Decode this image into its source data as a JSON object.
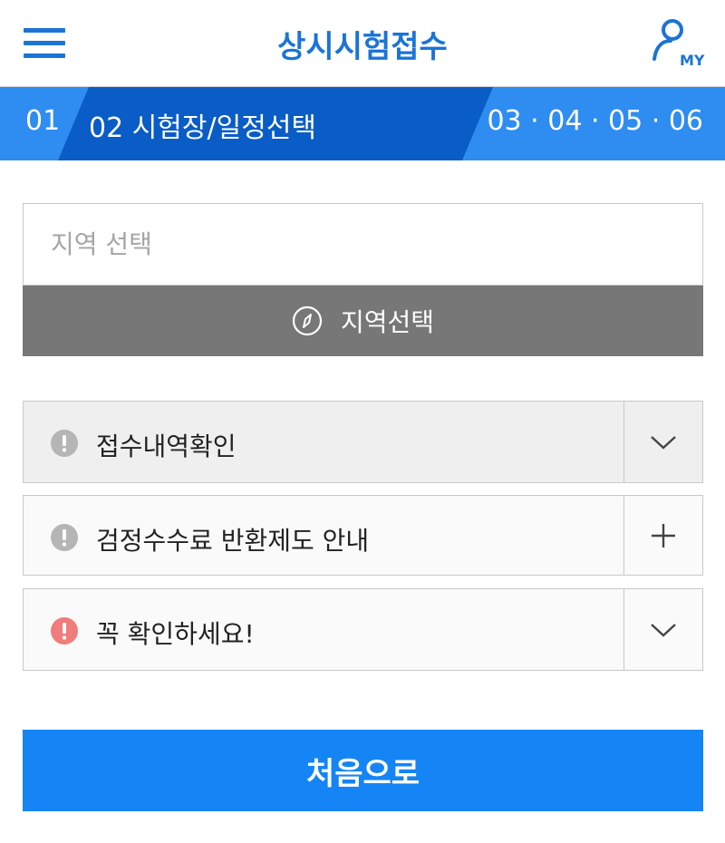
{
  "header": {
    "title": "상시시험접수",
    "my_label": "MY"
  },
  "steps": {
    "first": "01",
    "current": "02  시험장/일정선택",
    "rest": "03 · 04 · 05 · 06"
  },
  "region": {
    "placeholder": "지역 선택",
    "button_label": "지역선택"
  },
  "accordions": [
    {
      "label": "접수내역확인",
      "icon": "info-gray-icon",
      "toggle": "chevron-down-icon"
    },
    {
      "label": "검정수수료 반환제도 안내",
      "icon": "info-gray-icon",
      "toggle": "plus-icon"
    },
    {
      "label": "꼭 확인하세요!",
      "icon": "alert-red-icon",
      "toggle": "chevron-down-icon"
    }
  ],
  "home_button_label": "처음으로",
  "colors": {
    "brand_blue": "#1b74d6",
    "step_bar": "#2f8cf0",
    "step_active": "#0a5cc7",
    "region_button": "#777777",
    "primary_button": "#1584f5",
    "alert_red": "#f07c7c",
    "info_gray": "#b5b5b5"
  }
}
